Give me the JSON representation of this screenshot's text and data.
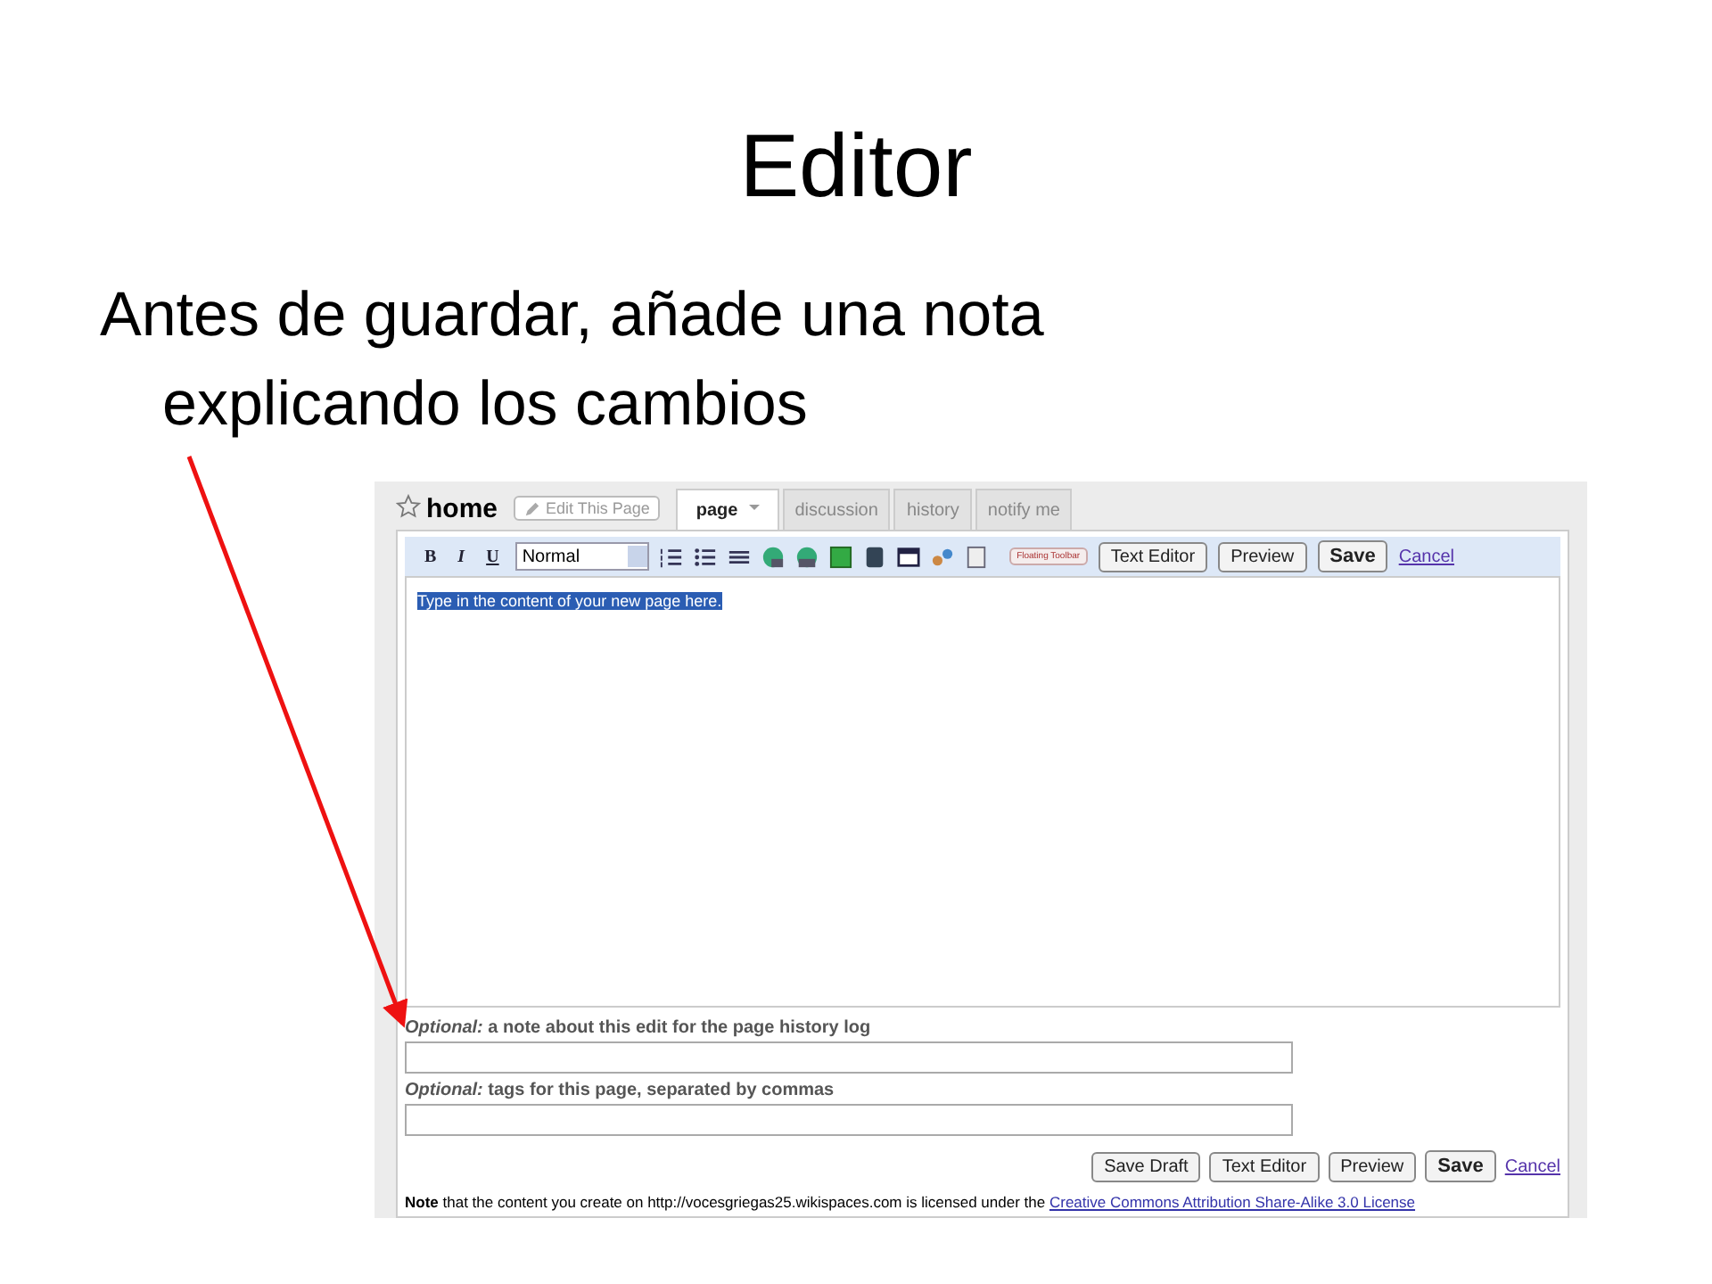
{
  "slide": {
    "title": "Editor",
    "bullet": "Antes de guardar, añade una nota explicando los cambios"
  },
  "screenshot": {
    "page_title": "home",
    "edit_button": "Edit This Page",
    "tabs": [
      {
        "label": "page",
        "selected": true,
        "kind": "dropdown"
      },
      {
        "label": "discussion",
        "selected": false,
        "kind": "plain"
      },
      {
        "label": "history",
        "selected": false,
        "kind": "plain"
      },
      {
        "label": "notify me",
        "selected": false,
        "kind": "plain"
      }
    ],
    "toolbar": {
      "format_buttons": [
        "B",
        "I",
        "U"
      ],
      "style_select": "Normal",
      "floating_toolbar": "Floating Toolbar",
      "buttons": [
        {
          "label": "Text Editor",
          "kind": "normal"
        },
        {
          "label": "Preview",
          "kind": "normal"
        },
        {
          "label": "Save",
          "kind": "primary"
        }
      ],
      "cancel": "Cancel"
    },
    "editor": {
      "selected_text": "Type in the content of your new page here."
    },
    "note_field": {
      "label": "*Optional:* a note about this edit for the page history log"
    },
    "tags_field": {
      "label": "*Optional:* tags for this page, separated by commas"
    },
    "bottom_buttons": [
      {
        "label": "Save Draft",
        "kind": "normal"
      },
      {
        "label": "Text Editor",
        "kind": "normal"
      },
      {
        "label": "Preview",
        "kind": "normal"
      },
      {
        "label": "Save",
        "kind": "primary"
      }
    ],
    "bottom_cancel": "Cancel",
    "license": {
      "text": "**Note** that the content you create on http://vocesgriegas25.wikispaces.com is licensed under the",
      "link": "Creative Commons Attribution Share-Alike 3.0 License"
    }
  }
}
